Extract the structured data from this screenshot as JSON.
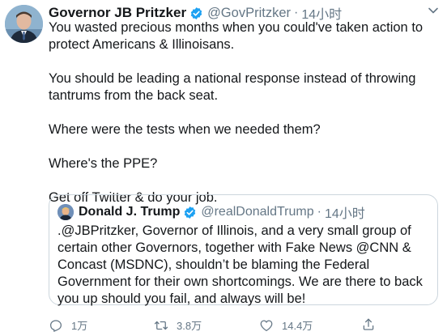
{
  "tweet": {
    "author_name": "Governor JB Pritzker",
    "author_handle": "@GovPritzker",
    "separator": "·",
    "time": "14小时",
    "paragraphs": [
      "You wasted precious months when you could've taken action to protect Americans & Illinoisans.",
      "You should be leading a national response instead of throwing tantrums from the back seat.",
      "Where were the tests when we needed them?",
      "Where's the PPE?",
      "Get off Twitter & do your job."
    ]
  },
  "quoted": {
    "author_name": "Donald J. Trump",
    "author_handle": "@realDonaldTrump",
    "separator": "·",
    "time": "14小时",
    "text": ".@JBPritzker, Governor of Illinois, and a very small group of certain other Governors, together with Fake News @CNN & Concast (MSDNC), shouldn’t be blaming the Federal Government for their own shortcomings. We are there to back you up should you fail, and always will be!"
  },
  "actions": {
    "reply_count": "1万",
    "retweet_count": "3.8万",
    "like_count": "14.4万"
  },
  "colors": {
    "verified": "#1da1f2",
    "secondary_text": "#657786",
    "border": "#ccd6dd"
  },
  "icons": [
    "verified-badge-icon",
    "chevron-down-icon",
    "reply-icon",
    "retweet-icon",
    "like-icon",
    "share-icon"
  ]
}
